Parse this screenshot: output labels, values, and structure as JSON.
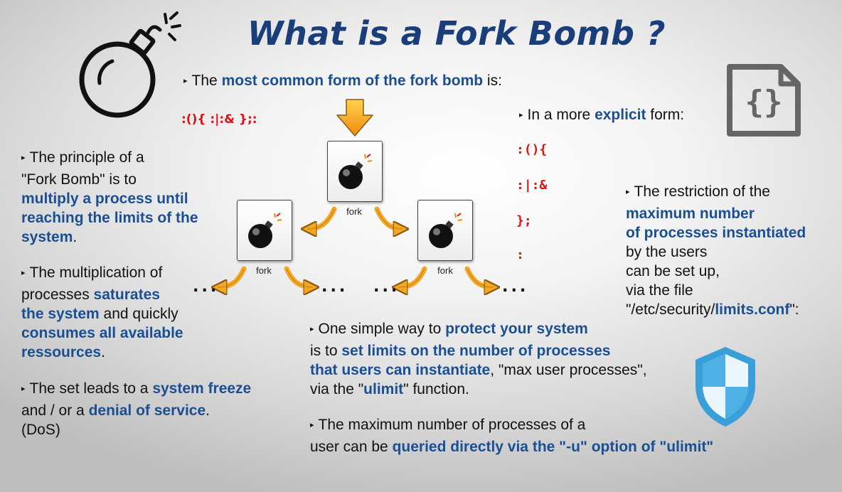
{
  "title": "What is a Fork Bomb ?",
  "bullet": "▸",
  "common_form": {
    "prefix": "The ",
    "highlight": "most common form of the fork bomb",
    "suffix": " is:",
    "code": ":(){ :|:& };:"
  },
  "explicit_form": {
    "prefix": "In a more ",
    "highlight": "explicit",
    "suffix": " form:",
    "lines": [
      ":(){",
      ":|:&",
      "};",
      ":"
    ]
  },
  "principle": {
    "line1": "The principle of a",
    "line2": "\"Fork Bomb\" is to",
    "hl1": "multiply a process until",
    "hl2": "reaching the limits of the",
    "hl3": "system",
    "end": "."
  },
  "multiplication": {
    "line1": "The multiplication of",
    "line2a": "processes ",
    "hl1": "saturates",
    "hl2": "the system",
    "line3b": " and quickly",
    "hl3": "consumes all available",
    "hl4": "ressources",
    "end": "."
  },
  "freeze": {
    "line1a": "The set leads to a ",
    "hl1": "system freeze",
    "line2a": "and / or a ",
    "hl2": "denial of service",
    "line2b": ".",
    "line3": "(DoS)"
  },
  "restriction": {
    "line1": "The restriction of the",
    "hl1": "maximum number",
    "hl2": "of processes instantiated",
    "line2": "by the users",
    "line3": "can be set up,",
    "line4": "via the file",
    "path_a": "\"/etc/security/",
    "path_hl": "limits.conf",
    "path_b": "\":"
  },
  "protect": {
    "line1a": "One simple way to ",
    "hl1": "protect your system",
    "line2a": "is to ",
    "hl2": "set limits on the number of processes",
    "hl3": "that users can instantiate",
    "line3b": ", \"max user processes\",",
    "line4a": "via the \"",
    "hl4": "ulimit",
    "line4b": "\" function."
  },
  "query": {
    "line1": "The maximum number of processes of a",
    "line2a": "user can be ",
    "hl1": "queried directly via the \"-u\" option of \"ulimit\""
  },
  "diagram": {
    "fork_label": "fork",
    "ellipsis": "..."
  },
  "colors": {
    "title": "#1a3e7a",
    "highlight": "#1a4f93",
    "code": "#e01010",
    "arrow": "#f5a623",
    "shield": "#3a9fd8"
  },
  "icons": [
    "bomb-icon",
    "code-file-icon",
    "shield-icon",
    "down-arrow-icon",
    "curved-arrow-icon"
  ]
}
